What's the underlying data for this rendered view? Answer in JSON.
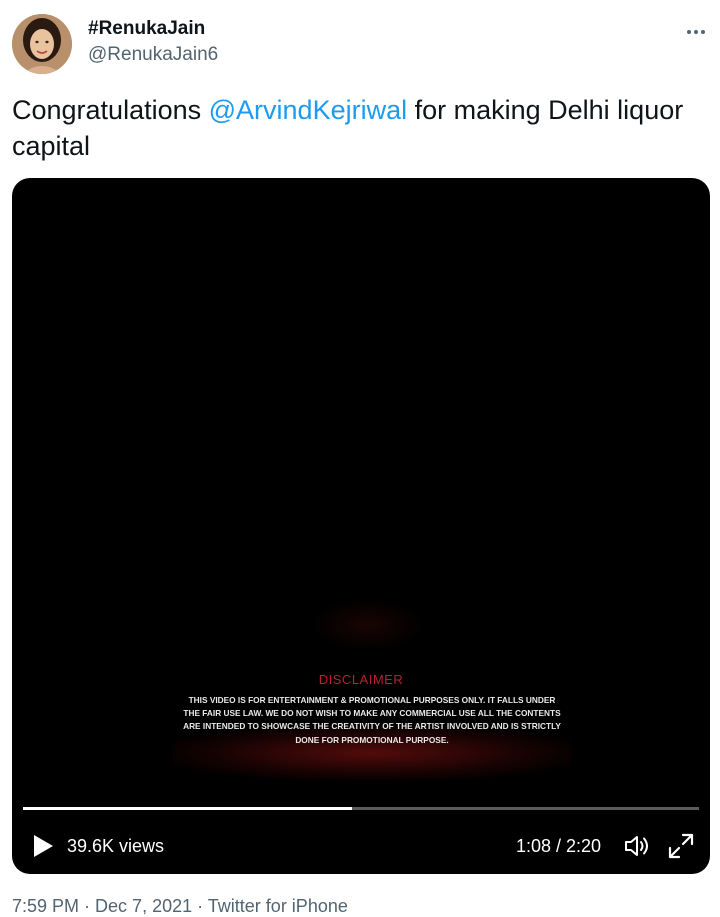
{
  "author": {
    "display_name": "#RenukaJain",
    "handle": "@RenukaJain6",
    "avatar_icon": "profile-photo"
  },
  "more_icon": "more-dots-icon",
  "tweet": {
    "text_before": "Congratulations ",
    "mention": "@ArvindKejriwal",
    "text_after": " for making Delhi liquor capital"
  },
  "video": {
    "disclaimer_title": "DISCLAIMER",
    "disclaimer_body": "THIS VIDEO IS FOR ENTERTAINMENT & PROMOTIONAL PURPOSES ONLY. IT FALLS UNDER THE FAIR USE LAW. WE DO NOT WISH TO MAKE ANY COMMERCIAL USE ALL THE CONTENTS ARE INTENDED TO SHOWCASE THE CREATIVITY OF THE ARTIST INVOLVED AND IS STRICTLY DONE FOR PROMOTIONAL PURPOSE.",
    "views": "39.6K views",
    "time": "1:08 / 2:20",
    "progress_fraction": 0.486,
    "play_icon": "play-icon",
    "volume_icon": "volume-icon",
    "fullscreen_icon": "fullscreen-icon"
  },
  "footer": {
    "time": "7:59 PM",
    "separator": " · ",
    "date": "Dec 7, 2021",
    "source": "Twitter for iPhone"
  },
  "colors": {
    "link": "#1d9bf0",
    "secondary_text": "#536471",
    "disclaimer_title": "#b8232a"
  }
}
